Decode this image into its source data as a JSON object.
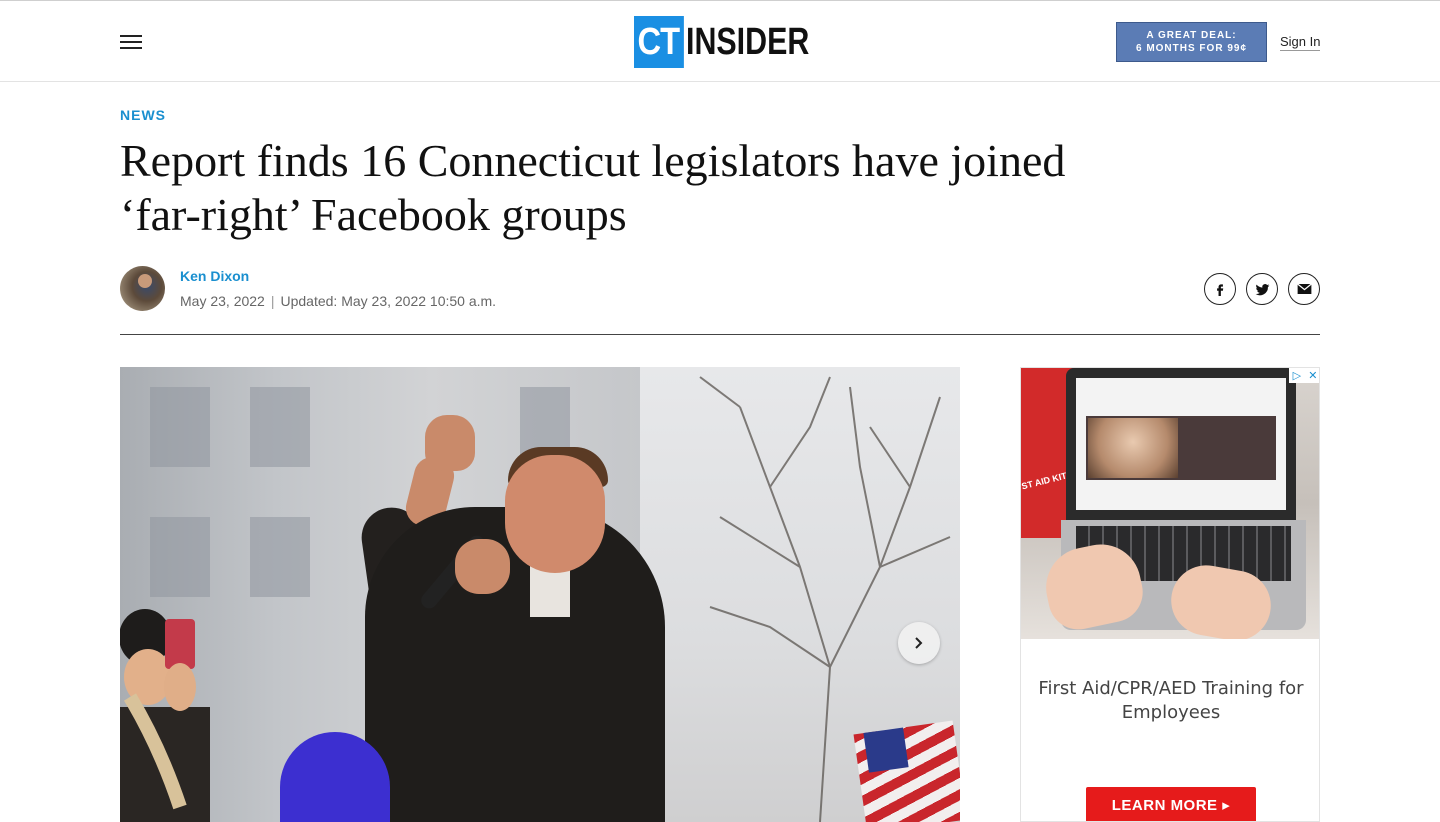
{
  "header": {
    "logo_ct": "CT",
    "logo_insider": "INSIDER",
    "deal_line1": "A GREAT DEAL:",
    "deal_line2": "6 MONTHS FOR 99¢",
    "sign_in": "Sign In"
  },
  "article": {
    "section": "NEWS",
    "headline": "Report finds 16 Connecticut legislators have joined ‘far-right’ Facebook groups",
    "author": "Ken Dixon",
    "date": "May 23, 2022",
    "separator": "|",
    "updated": "Updated: May 23, 2022 10:50 a.m."
  },
  "share": {
    "facebook": "facebook-icon",
    "twitter": "twitter-icon",
    "email": "email-icon"
  },
  "ad": {
    "kit_text": "ST AID KIT",
    "headline": "First Aid/CPR/AED Training for Employees",
    "cta": "LEARN MORE ▸",
    "cta_color": "#e61b1b"
  },
  "colors": {
    "accent": "#1a8fcf",
    "logo_blue": "#1a8fe3",
    "deal_button": "#5b7cb5"
  }
}
